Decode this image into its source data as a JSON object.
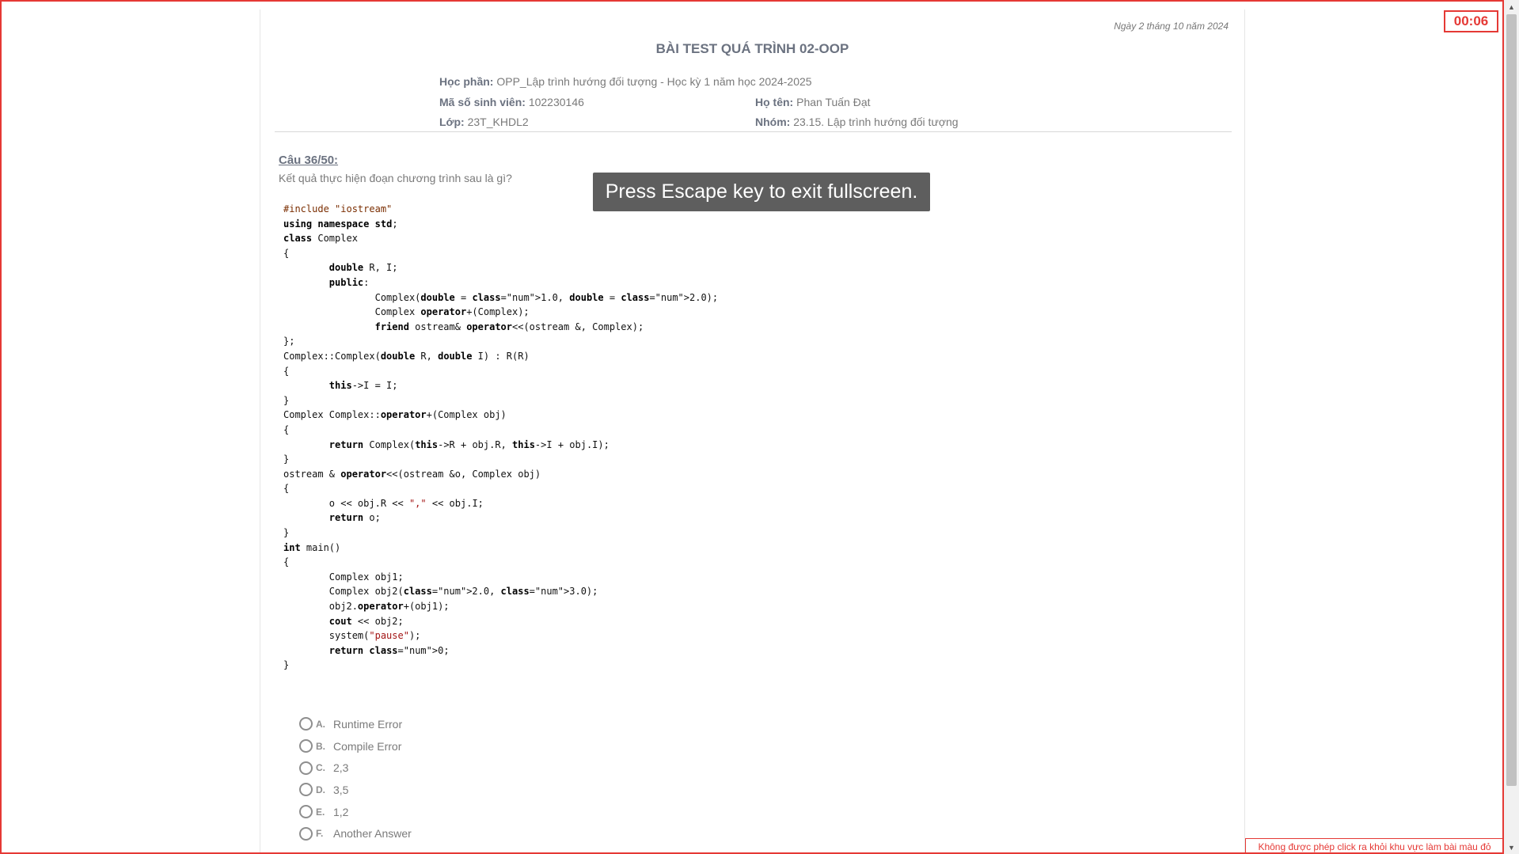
{
  "header": {
    "date": "Ngày 2 tháng 10 năm 2024",
    "title": "BÀI TEST QUÁ TRÌNH 02-OOP",
    "course_label": "Học phần:",
    "course_value": "OPP_Lập trình hướng đối tượng - Học kỳ 1 năm học 2024-2025",
    "student_id_label": "Mã số sinh viên:",
    "student_id_value": "102230146",
    "name_label": "Họ tên:",
    "name_value": "Phan Tuấn Đạt",
    "class_label": "Lớp:",
    "class_value": "23T_KHDL2",
    "group_label": "Nhóm:",
    "group_value": "23.15. Lập trình hướng đối tượng"
  },
  "question": {
    "number": "Câu 36/50:",
    "text": "Kết quả thực hiện đoạn chương trình sau là gì?",
    "code_lines": [
      "#include \"iostream\"",
      "using namespace std;",
      "class Complex",
      "{",
      "        double R, I;",
      "        public:",
      "                Complex(double = 1.0, double = 2.0);",
      "                Complex operator+(Complex);",
      "                friend ostream& operator<<(ostream &, Complex);",
      "};",
      "Complex::Complex(double R, double I) : R(R)",
      "{",
      "        this->I = I;",
      "}",
      "Complex Complex::operator+(Complex obj)",
      "{",
      "        return Complex(this->R + obj.R, this->I + obj.I);",
      "}",
      "ostream & operator<<(ostream &o, Complex obj)",
      "{",
      "        o << obj.R << \",\" << obj.I;",
      "        return o;",
      "}",
      "int main()",
      "{",
      "        Complex obj1;",
      "        Complex obj2(2.0, 3.0);",
      "        obj2.operator+(obj1);",
      "        cout << obj2;",
      "        system(\"pause\");",
      "        return 0;",
      "}"
    ],
    "options": [
      {
        "letter": "A.",
        "text": "Runtime Error"
      },
      {
        "letter": "B.",
        "text": "Compile Error"
      },
      {
        "letter": "C.",
        "text": "2,3"
      },
      {
        "letter": "D.",
        "text": "3,5"
      },
      {
        "letter": "E.",
        "text": "1,2"
      },
      {
        "letter": "F.",
        "text": "Another Answer"
      }
    ]
  },
  "overlay": {
    "fullscreen_notice": "Press Escape key to exit fullscreen."
  },
  "timer": "00:06",
  "warning": "Không được phép click ra khỏi khu vực làm bài màu đỏ",
  "colors": {
    "accent_red": "#e53935",
    "text_gray": "#6b7280",
    "toast_bg": "#555555"
  }
}
